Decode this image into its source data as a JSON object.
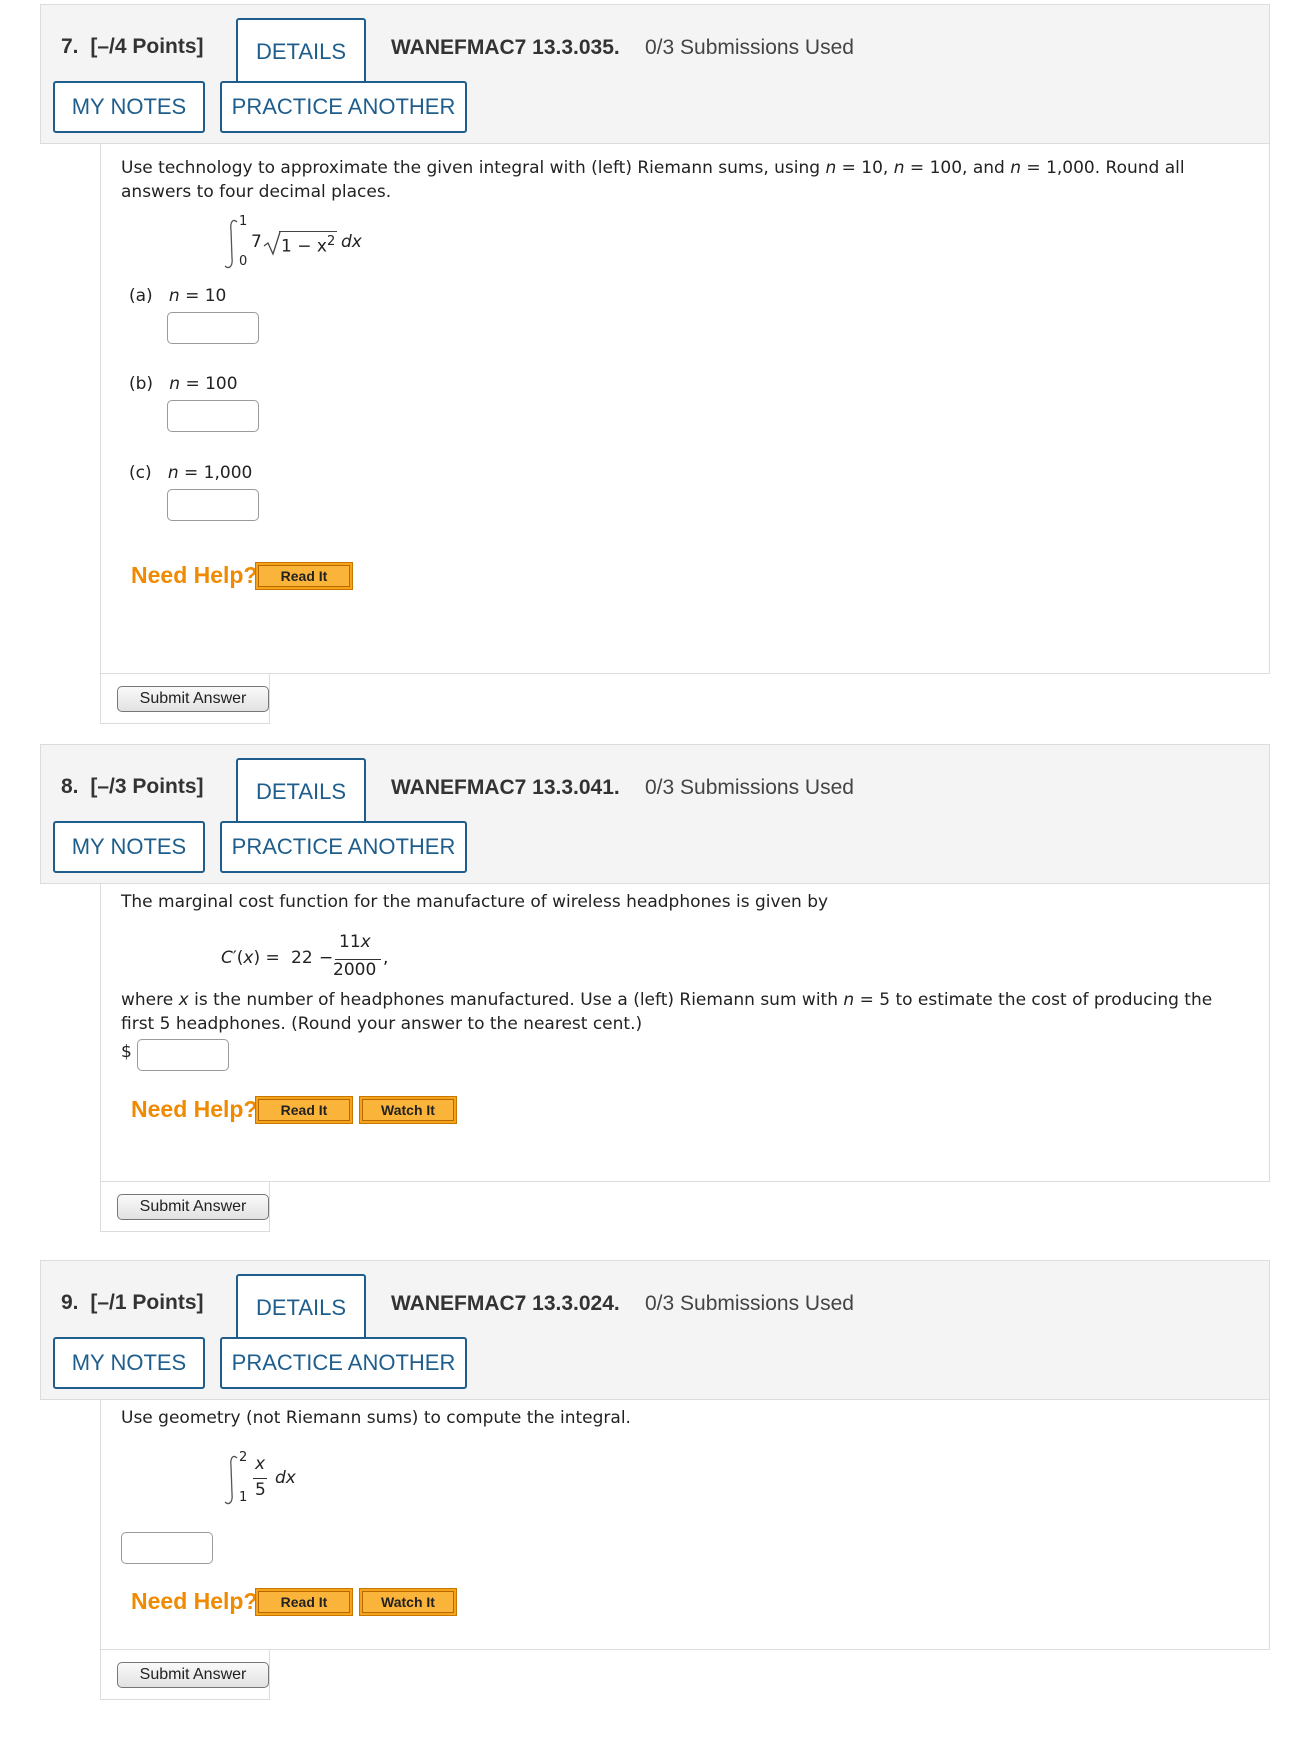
{
  "q7": {
    "number": "7.",
    "points": "[–/4 Points]",
    "details": "DETAILS",
    "code": "WANEFMAC7 13.3.035.",
    "submissions": "0/3 Submissions Used",
    "my_notes": "MY NOTES",
    "practice": "PRACTICE ANOTHER",
    "prompt_a": "Use technology to approximate the given integral with (left) Riemann sums, using ",
    "prompt_line2": "answers to four decimal places.",
    "prompt_n": "n",
    "prompt_eq1": " = 10, ",
    "prompt_eq2": " = 100, and ",
    "prompt_eq3": " = 1,000. Round all",
    "integral": {
      "upper": "1",
      "lower": "0",
      "coef": "7",
      "radicand": "1 − x",
      "exp": "2",
      "dx": "dx"
    },
    "parts": [
      {
        "label": "(a)",
        "n": "n",
        "value": "= 10"
      },
      {
        "label": "(b)",
        "n": "n",
        "value": "= 100"
      },
      {
        "label": "(c)",
        "n": "n",
        "value": "= 1,000"
      }
    ],
    "need_help": "Need Help?",
    "read_it": "Read It",
    "submit": "Submit Answer"
  },
  "q8": {
    "number": "8.",
    "points": "[–/3 Points]",
    "details": "DETAILS",
    "code": "WANEFMAC7 13.3.041.",
    "submissions": "0/3 Submissions Used",
    "my_notes": "MY NOTES",
    "practice": "PRACTICE ANOTHER",
    "prompt": "The marginal cost function for the manufacture of wireless headphones is given by",
    "formula": {
      "lhs": "C′(x) = ",
      "const": "22",
      "minus": "−",
      "num": "11x",
      "den": "2000",
      "trail": ","
    },
    "prompt2_a": "where ",
    "prompt2_x": "x",
    "prompt2_b": " is the number of headphones manufactured. Use a (left) Riemann sum with ",
    "prompt2_n": "n",
    "prompt2_c": " = 5 to estimate the cost of producing the",
    "prompt3": "first 5 headphones. (Round your answer to the nearest cent.)",
    "dollar": "$",
    "need_help": "Need Help?",
    "read_it": "Read It",
    "watch_it": "Watch It",
    "submit": "Submit Answer"
  },
  "q9": {
    "number": "9.",
    "points": "[–/1 Points]",
    "details": "DETAILS",
    "code": "WANEFMAC7 13.3.024.",
    "submissions": "0/3 Submissions Used",
    "my_notes": "MY NOTES",
    "practice": "PRACTICE ANOTHER",
    "prompt": "Use geometry (not Riemann sums) to compute the integral.",
    "integral": {
      "upper": "2",
      "lower": "1",
      "num": "x",
      "den": "5",
      "dx": "dx"
    },
    "need_help": "Need Help?",
    "read_it": "Read It",
    "watch_it": "Watch It",
    "submit": "Submit Answer"
  },
  "colors": {
    "accent": "#1f5e8c",
    "need_help": "#f08a00",
    "math_red": "#d01010",
    "help_button": "#f7a21b"
  }
}
